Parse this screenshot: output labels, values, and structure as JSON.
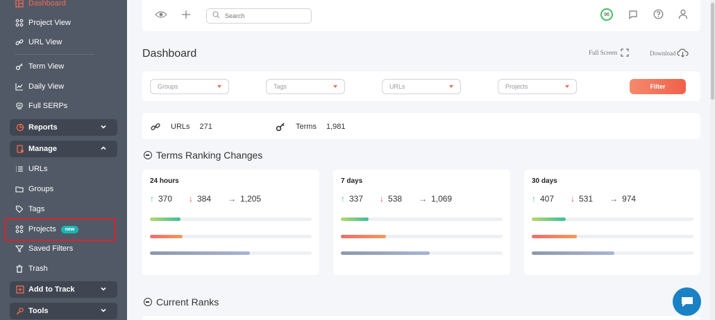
{
  "sidebar": {
    "dashboard": "Dashboard",
    "project_view": "Project View",
    "url_view": "URL View",
    "term_view": "Term View",
    "daily_view": "Daily View",
    "full_serps": "Full SERPs",
    "reports": "Reports",
    "manage": "Manage",
    "urls": "URLs",
    "groups": "Groups",
    "tags": "Tags",
    "projects": "Projects",
    "projects_badge": "new",
    "saved_filters": "Saved Filters",
    "trash": "Trash",
    "add_to_track": "Add to Track",
    "tools": "Tools"
  },
  "topbar": {
    "search_placeholder": "Search",
    "score": "96"
  },
  "page": {
    "title": "Dashboard",
    "full_screen": "Full Screen",
    "download": "Download"
  },
  "filters": {
    "groups": "Groups",
    "tags": "Tags",
    "urls": "URLs",
    "projects": "Projects",
    "filter_button": "Filter"
  },
  "stats": {
    "urls_label": "URLs",
    "urls_value": "271",
    "terms_label": "Terms",
    "terms_value": "1,981"
  },
  "sections": {
    "terms_ranking": "Terms Ranking Changes",
    "current_ranks": "Current Ranks"
  },
  "cards": [
    {
      "period": "24 hours",
      "up": "370",
      "down": "384",
      "same": "1,205",
      "up_frac": 0.19,
      "down_frac": 0.2,
      "same_frac": 0.62
    },
    {
      "period": "7 days",
      "up": "337",
      "down": "538",
      "same": "1,069",
      "up_frac": 0.17,
      "down_frac": 0.28,
      "same_frac": 0.55
    },
    {
      "period": "30 days",
      "up": "407",
      "down": "531",
      "same": "974",
      "up_frac": 0.21,
      "down_frac": 0.28,
      "same_frac": 0.51
    }
  ],
  "colors": {
    "sidebar_bg": "#515966",
    "accent": "#f26b52",
    "up": "#3fbf7f",
    "down": "#e8454a"
  }
}
